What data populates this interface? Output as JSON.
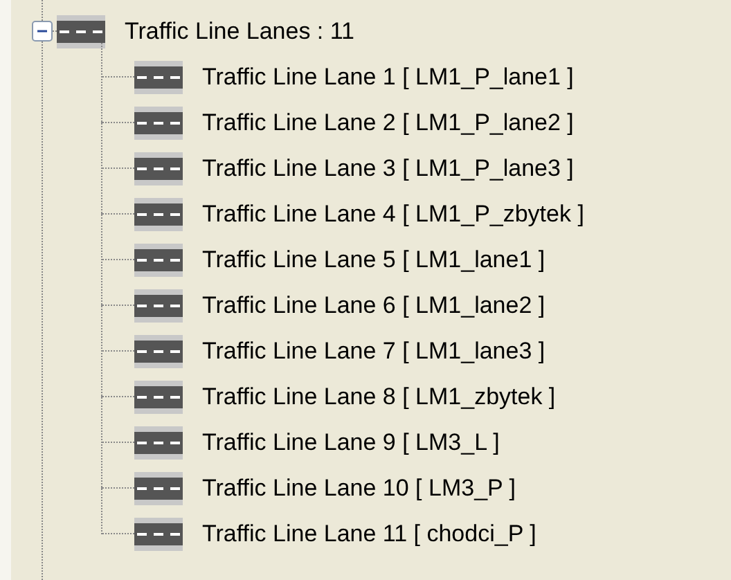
{
  "tree": {
    "label": "Traffic Line Lanes : 11",
    "expanded": true,
    "children": [
      {
        "label": "Traffic Line Lane 1 [ LM1_P_lane1 ]"
      },
      {
        "label": "Traffic Line Lane 2 [ LM1_P_lane2 ]"
      },
      {
        "label": "Traffic Line Lane 3 [ LM1_P_lane3 ]"
      },
      {
        "label": "Traffic Line Lane 4 [ LM1_P_zbytek ]"
      },
      {
        "label": "Traffic Line Lane 5 [ LM1_lane1 ]"
      },
      {
        "label": "Traffic Line Lane 6 [ LM1_lane2 ]"
      },
      {
        "label": "Traffic Line Lane 7 [ LM1_lane3 ]"
      },
      {
        "label": "Traffic Line Lane 8 [ LM1_zbytek ]"
      },
      {
        "label": "Traffic Line Lane 9 [ LM3_L ]"
      },
      {
        "label": "Traffic Line Lane 10 [ LM3_P ]"
      },
      {
        "label": "Traffic Line Lane 11 [ chodci_P ]"
      }
    ]
  }
}
